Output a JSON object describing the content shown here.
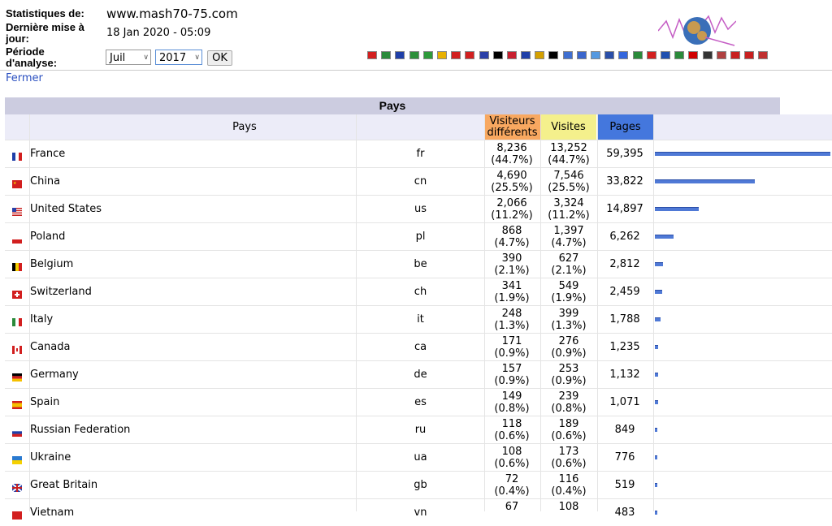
{
  "header": {
    "stats_label": "Statistiques de:",
    "site": "www.mash70-75.com",
    "updated_label": "Dernière mise à jour:",
    "updated_value": "18 Jan 2020 - 05:09",
    "period_label": "Période d'analyse:",
    "month": "Juil",
    "year": "2017",
    "ok_label": "OK"
  },
  "fermer": "Fermer",
  "flags_colors": [
    "#d21f1f",
    "#2a8a3a",
    "#1f3fa8",
    "#2c8f3a",
    "#2d9a3a",
    "#e8b000",
    "#d22020",
    "#d22020",
    "#2a3fa8",
    "#000000",
    "#c82030",
    "#1f3fa8",
    "#d4a000",
    "#000000",
    "#3f6fd0",
    "#3a66cc",
    "#5599e0",
    "#2a4fa8",
    "#3366dd",
    "#2a8a3a",
    "#d22020",
    "#2050b0",
    "#2a8a3a",
    "#d00000",
    "#333333",
    "#b04040",
    "#c82020",
    "#c82020",
    "#c03030"
  ],
  "table": {
    "title": "Pays",
    "col_pays": "Pays",
    "col_visitors": "Visiteurs différents",
    "col_visits": "Visites",
    "col_pages": "Pages",
    "visitors_color": "#f8a860",
    "visits_color": "#f4f08c",
    "pages_color": "#4477dd",
    "rows": [
      {
        "flag": "fr",
        "name": "France",
        "code": "fr",
        "visitors": "8,236",
        "visitors_pct": "(44.7%)",
        "visits": "13,252",
        "visits_pct": "(44.7%)",
        "pages": "59,395",
        "pages_value": 59395
      },
      {
        "flag": "cn",
        "name": "China",
        "code": "cn",
        "visitors": "4,690",
        "visitors_pct": "(25.5%)",
        "visits": "7,546",
        "visits_pct": "(25.5%)",
        "pages": "33,822",
        "pages_value": 33822
      },
      {
        "flag": "us",
        "name": "United States",
        "code": "us",
        "visitors": "2,066",
        "visitors_pct": "(11.2%)",
        "visits": "3,324",
        "visits_pct": "(11.2%)",
        "pages": "14,897",
        "pages_value": 14897
      },
      {
        "flag": "pl",
        "name": "Poland",
        "code": "pl",
        "visitors": "868",
        "visitors_pct": "(4.7%)",
        "visits": "1,397",
        "visits_pct": "(4.7%)",
        "pages": "6,262",
        "pages_value": 6262
      },
      {
        "flag": "be",
        "name": "Belgium",
        "code": "be",
        "visitors": "390",
        "visitors_pct": "(2.1%)",
        "visits": "627",
        "visits_pct": "(2.1%)",
        "pages": "2,812",
        "pages_value": 2812
      },
      {
        "flag": "ch",
        "name": "Switzerland",
        "code": "ch",
        "visitors": "341",
        "visitors_pct": "(1.9%)",
        "visits": "549",
        "visits_pct": "(1.9%)",
        "pages": "2,459",
        "pages_value": 2459
      },
      {
        "flag": "it",
        "name": "Italy",
        "code": "it",
        "visitors": "248",
        "visitors_pct": "(1.3%)",
        "visits": "399",
        "visits_pct": "(1.3%)",
        "pages": "1,788",
        "pages_value": 1788
      },
      {
        "flag": "ca",
        "name": "Canada",
        "code": "ca",
        "visitors": "171",
        "visitors_pct": "(0.9%)",
        "visits": "276",
        "visits_pct": "(0.9%)",
        "pages": "1,235",
        "pages_value": 1235
      },
      {
        "flag": "de",
        "name": "Germany",
        "code": "de",
        "visitors": "157",
        "visitors_pct": "(0.9%)",
        "visits": "253",
        "visits_pct": "(0.9%)",
        "pages": "1,132",
        "pages_value": 1132
      },
      {
        "flag": "es",
        "name": "Spain",
        "code": "es",
        "visitors": "149",
        "visitors_pct": "(0.8%)",
        "visits": "239",
        "visits_pct": "(0.8%)",
        "pages": "1,071",
        "pages_value": 1071
      },
      {
        "flag": "ru",
        "name": "Russian Federation",
        "code": "ru",
        "visitors": "118",
        "visitors_pct": "(0.6%)",
        "visits": "189",
        "visits_pct": "(0.6%)",
        "pages": "849",
        "pages_value": 849
      },
      {
        "flag": "ua",
        "name": "Ukraine",
        "code": "ua",
        "visitors": "108",
        "visitors_pct": "(0.6%)",
        "visits": "173",
        "visits_pct": "(0.6%)",
        "pages": "776",
        "pages_value": 776
      },
      {
        "flag": "gb",
        "name": "Great Britain",
        "code": "gb",
        "visitors": "72",
        "visitors_pct": "(0.4%)",
        "visits": "116",
        "visits_pct": "(0.4%)",
        "pages": "519",
        "pages_value": 519
      },
      {
        "flag": "vn",
        "name": "Vietnam",
        "code": "vn",
        "visitors": "67",
        "visitors_pct": "",
        "visits": "108",
        "visits_pct": "",
        "pages": "483",
        "pages_value": 483
      }
    ]
  }
}
